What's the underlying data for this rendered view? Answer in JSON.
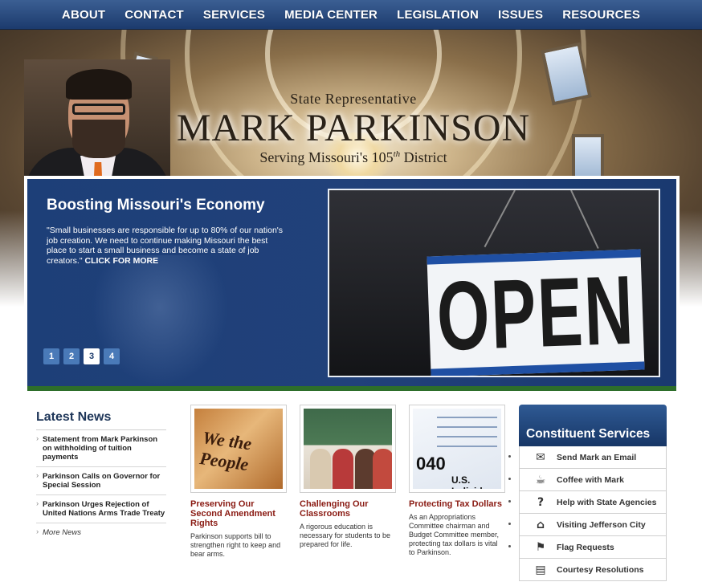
{
  "nav": {
    "items": [
      "ABOUT",
      "CONTACT",
      "SERVICES",
      "MEDIA CENTER",
      "LEGISLATION",
      "ISSUES",
      "RESOURCES"
    ]
  },
  "header": {
    "subtitle_top": "State Representative",
    "name": "MARK PARKINSON",
    "subtitle_bottom_prefix": "Serving Missouri's 105",
    "subtitle_bottom_sup": "th",
    "subtitle_bottom_suffix": " District"
  },
  "slider": {
    "title": "Boosting Missouri's Economy",
    "text": "\"Small businesses are responsible for up to 80% of our nation's job creation. We need to continue making Missouri the best place to start a small business and become a state of job creators.\"",
    "more_link": "CLICK FOR MORE",
    "sign_text": "OPEN",
    "pages": [
      "1",
      "2",
      "3",
      "4"
    ],
    "active_page": "3"
  },
  "news": {
    "heading": "Latest News",
    "items": [
      "Statement from Mark Parkinson on withholding of tuition payments",
      "Parkinson Calls on Governor for Special Session",
      "Parkinson Urges Rejection of United Nations Arms Trade Treaty"
    ],
    "more": "More News"
  },
  "features": [
    {
      "title": "Preserving Our Second Amendment Rights",
      "text": "Parkinson supports bill to strengthen right to keep and bear arms.",
      "image_text": "We the People"
    },
    {
      "title": "Challenging Our Classrooms",
      "text": "A rigorous education is necessary for students to be prepared for life."
    },
    {
      "title": "Protecting Tax Dollars",
      "text": "As an Appropriations Committee chairman and Budget Committee member, protecting tax dollars is vital to Parkinson.",
      "image_text_big": "040",
      "image_text_small": "U.S. Individu"
    }
  ],
  "services": {
    "heading": "Constituent Services",
    "items": [
      {
        "label": "Send Mark an Email",
        "icon": "envelope-icon",
        "glyph": "✉"
      },
      {
        "label": "Coffee with Mark",
        "icon": "coffee-cup-icon",
        "glyph": "☕"
      },
      {
        "label": "Help with State Agencies",
        "icon": "question-mark-icon",
        "glyph": "?"
      },
      {
        "label": "Visiting Jefferson City",
        "icon": "capitol-icon",
        "glyph": "⌂"
      },
      {
        "label": "Flag Requests",
        "icon": "flag-icon",
        "glyph": "⚑"
      },
      {
        "label": "Courtesy Resolutions",
        "icon": "document-icon",
        "glyph": "▤"
      }
    ]
  },
  "colors": {
    "nav": "#1c3b6d",
    "slide": "#1d3f78",
    "feature_title": "#8a1b13",
    "accent_green": "#2d6e2a"
  }
}
